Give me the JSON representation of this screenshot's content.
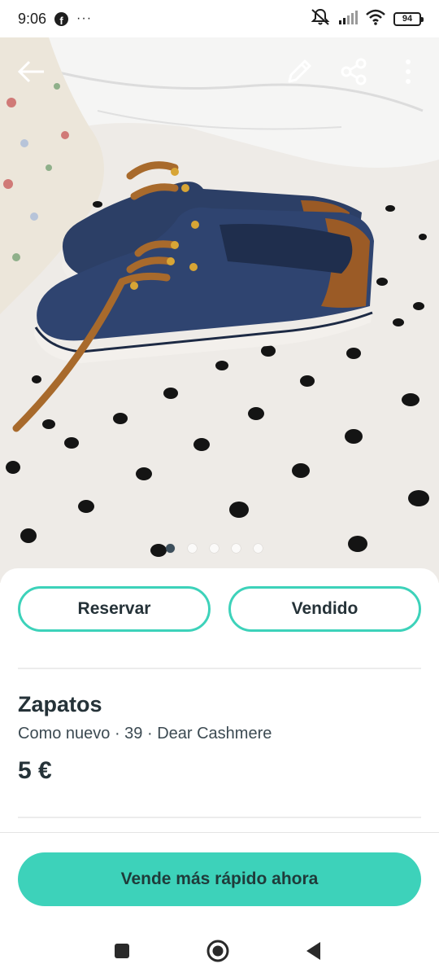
{
  "status_bar": {
    "time": "9:06",
    "more_indicator": "···",
    "battery_level": "94",
    "icons": [
      "facebook-icon",
      "mute-icon",
      "signal-icon",
      "wifi-icon",
      "battery-icon"
    ]
  },
  "gallery": {
    "image_count": 5,
    "active_index": 0,
    "icons": [
      "back-arrow-icon",
      "pencil-icon",
      "share-icon",
      "more-vertical-icon"
    ]
  },
  "actions": {
    "reserve_label": "Reservar",
    "sold_label": "Vendido"
  },
  "item": {
    "title": "Zapatos",
    "meta": "Como nuevo · 39 · Dear Cashmere",
    "price": "5 €"
  },
  "cta": {
    "label": "Vende más rápido ahora"
  },
  "colors": {
    "accent": "#3dd2ba",
    "text": "#253238",
    "active_dot": "#3d4f5c"
  },
  "nav": {
    "icons": [
      "recents-square-icon",
      "home-circle-icon",
      "back-triangle-icon"
    ]
  }
}
